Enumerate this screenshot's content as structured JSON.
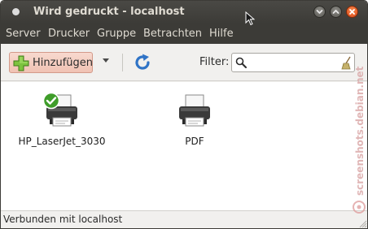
{
  "window": {
    "title": "Wird gedruckt - localhost"
  },
  "menubar": {
    "items": [
      {
        "label": "Server"
      },
      {
        "label": "Drucker"
      },
      {
        "label": "Gruppe"
      },
      {
        "label": "Betrachten"
      },
      {
        "label": "Hilfe"
      }
    ]
  },
  "toolbar": {
    "add_label": "Hinzufügen",
    "filter_label": "Filter:",
    "filter_value": ""
  },
  "printers": [
    {
      "name": "HP_LaserJet_3030",
      "is_default": true
    },
    {
      "name": "PDF",
      "is_default": false
    }
  ],
  "statusbar": {
    "text": "Verbunden mit localhost"
  },
  "watermark": {
    "text": "screenshots.debian.net"
  },
  "colors": {
    "titlebar": "#3c3b37",
    "close_button": "#e25b25",
    "add_button_bg": "#f3c8b9",
    "refresh_blue": "#2f73c6",
    "default_check": "#3f9d2a"
  }
}
